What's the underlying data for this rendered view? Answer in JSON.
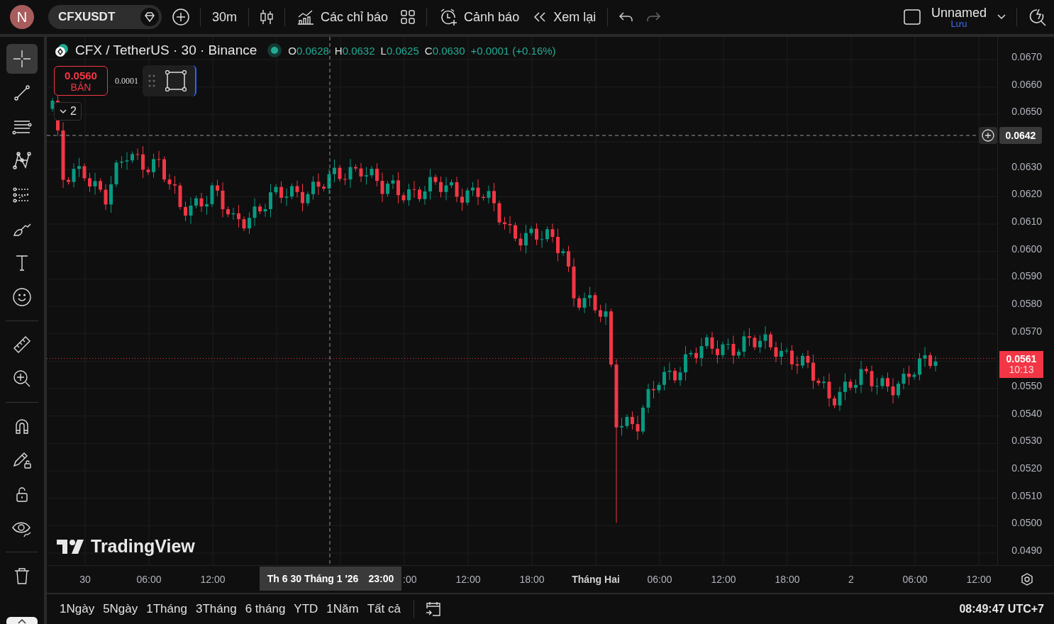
{
  "top_bar": {
    "avatar": "N",
    "symbol": "CFXUSDT",
    "interval": "30m",
    "indicators": "Các chỉ báo",
    "alerts": "Cảnh báo",
    "replay": "Xem lại",
    "undo_disabled": false,
    "redo_disabled": true,
    "layout_name": "Unnamed",
    "layout_save": "Lưu"
  },
  "left_toolbar": {
    "groups": [
      [
        {
          "kind": "crosshair",
          "selected": true
        },
        {
          "kind": "trend-line",
          "selected": false
        },
        {
          "kind": "horizontal-lines",
          "selected": false
        },
        {
          "kind": "pattern",
          "selected": false
        },
        {
          "kind": "forecast-lines",
          "selected": false
        },
        {
          "kind": "brush",
          "selected": false
        },
        {
          "kind": "text",
          "selected": false
        },
        {
          "kind": "emoji",
          "selected": false
        }
      ],
      [
        {
          "kind": "ruler",
          "selected": false
        },
        {
          "kind": "zoom-in",
          "selected": false
        }
      ],
      [
        {
          "kind": "magnet",
          "selected": false
        },
        {
          "kind": "pencil-lock",
          "selected": false
        },
        {
          "kind": "lock",
          "selected": false
        },
        {
          "kind": "eye",
          "selected": false
        }
      ],
      [
        {
          "kind": "trash",
          "selected": false
        }
      ]
    ]
  },
  "legend": {
    "title": "CFX / TetherUS · 30 · Binance",
    "values": [
      {
        "label": "O",
        "value": "0.0628"
      },
      {
        "label": "H",
        "value": "0.0632"
      },
      {
        "label": "L",
        "value": "0.0625"
      },
      {
        "label": "C",
        "value": "0.0630"
      }
    ],
    "change": "+0.0001 (+0.16%)"
  },
  "trade": {
    "sell_price": "0.0560",
    "sell_label": "BÁN",
    "spread": "0.0001"
  },
  "indicator_toggle": "2",
  "watermark_logo": "TradingView",
  "price_axis": {
    "labels": [
      "0.0670",
      "0.0660",
      "0.0650",
      "0.0630",
      "0.0620",
      "0.0610",
      "0.0600",
      "0.0590",
      "0.0580",
      "0.0570",
      "0.0550",
      "0.0540",
      "0.0530",
      "0.0520",
      "0.0510",
      "0.0500",
      "0.0490"
    ],
    "crosshair_price": "0.0642",
    "last_price": "0.0561",
    "countdown": "10:13"
  },
  "time_axis": {
    "labels": [
      {
        "text": "30",
        "kind": "tick"
      },
      {
        "text": "06:00",
        "kind": "tick"
      },
      {
        "text": "12:00",
        "kind": "tick"
      },
      {
        "text": ":00",
        "kind": "partial"
      },
      {
        "text": "12:00",
        "kind": "tick"
      },
      {
        "text": "18:00",
        "kind": "tick"
      },
      {
        "text": "Tháng Hai",
        "kind": "major"
      },
      {
        "text": "06:00",
        "kind": "tick"
      },
      {
        "text": "12:00",
        "kind": "tick"
      },
      {
        "text": "18:00",
        "kind": "tick"
      },
      {
        "text": "2",
        "kind": "tick"
      },
      {
        "text": "06:00",
        "kind": "tick"
      },
      {
        "text": "12:00",
        "kind": "tick"
      }
    ],
    "crosshair_date": "Th 6 30 Tháng 1 '26",
    "crosshair_time": "23:00"
  },
  "bottom_bar": {
    "ranges": [
      "1Ngày",
      "5Ngày",
      "1Tháng",
      "3Tháng",
      "6 tháng",
      "YTD",
      "1Năm",
      "Tất cả"
    ],
    "clock": "08:49:47 UTC+7"
  }
}
